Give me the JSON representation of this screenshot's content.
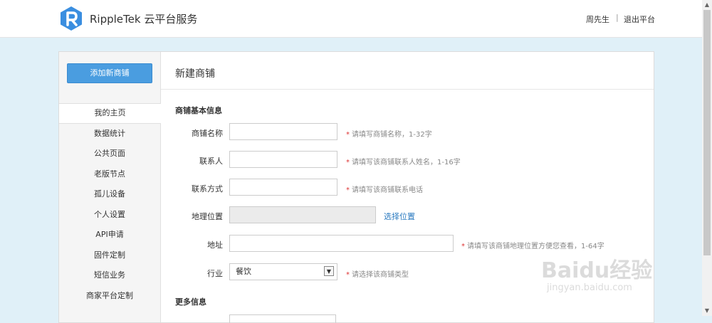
{
  "header": {
    "brand": "RippleTek 云平台服务",
    "user_name": "周先生",
    "separator": "|",
    "logout_label": "退出平台",
    "logo_color": "#3a8ee0"
  },
  "sidebar": {
    "add_button_label": "添加新商铺",
    "items": [
      {
        "label": "我的主页",
        "active": true
      },
      {
        "label": "数据统计"
      },
      {
        "label": "公共页面"
      },
      {
        "label": "老版节点"
      },
      {
        "label": "孤儿设备"
      },
      {
        "label": "个人设置"
      },
      {
        "label": "API申请"
      },
      {
        "label": "固件定制"
      },
      {
        "label": "短信业务"
      },
      {
        "label": "商家平台定制"
      }
    ]
  },
  "main": {
    "title": "新建商铺",
    "section_basic": "商铺基本信息",
    "section_more": "更多信息",
    "fields": {
      "shop_name": {
        "label": "商铺名称",
        "value": "",
        "hint": "请填写商铺名称，1-32字"
      },
      "contact": {
        "label": "联系人",
        "value": "",
        "hint": "请填写该商铺联系人姓名，1-16字"
      },
      "phone": {
        "label": "联系方式",
        "value": "",
        "hint": "请填写该商铺联系电话"
      },
      "location": {
        "label": "地理位置",
        "value": "",
        "link": "选择位置"
      },
      "address": {
        "label": "地址",
        "value": "",
        "hint": "请填写该商铺地理位置方便您查看，1-64字"
      },
      "industry": {
        "label": "行业",
        "value": "餐饮",
        "hint": "请选择该商铺类型"
      }
    },
    "required_mark": "*"
  },
  "watermark": {
    "main": "Baidu经验",
    "sub": "jingyan.baidu.com"
  },
  "colors": {
    "accent": "#4a9de0",
    "link": "#2a7ac0",
    "required": "#d33333",
    "background": "#e0f0f8"
  }
}
